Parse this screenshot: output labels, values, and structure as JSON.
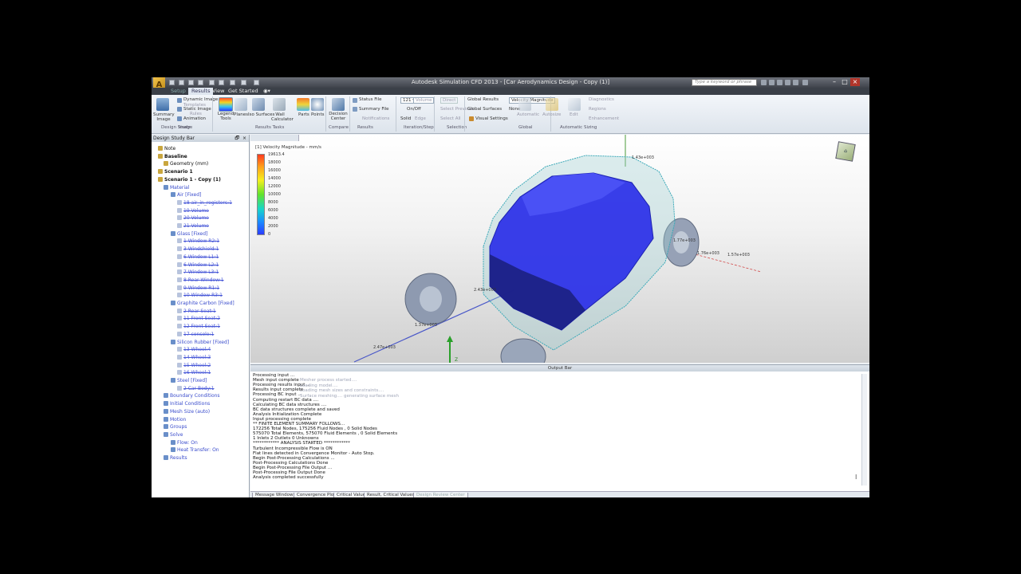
{
  "window": {
    "logo_letter": "A",
    "title": "Autodesk Simulation CFD 2013 - [Car Aerodynamics Design - Copy (1)]",
    "search_placeholder": "Type a keyword or phrase",
    "minimize": "–",
    "maximize": "□",
    "close": "×"
  },
  "tabs": [
    "Setup",
    "Results",
    "View",
    "Get Started"
  ],
  "ribbon": {
    "summary_image": "Summary Image",
    "dynamic_image": "Dynamic Image",
    "static_image": "Static Image",
    "animation": "Animation",
    "templates": "Templates",
    "rules": "Rules",
    "legend_tools": "Legend Tools",
    "planes": "Planes",
    "iso_surfaces": "Iso Surfaces",
    "wall_calculator": "Wall Calculator",
    "parts": "Parts",
    "points": "Points",
    "decision_center": "Decision Center",
    "status_file": "Status File",
    "summary_file": "Summary File",
    "notifications": "Notifications",
    "volume": "Volume",
    "on_off": "On/Off",
    "solid": "Solid",
    "edge": "Edge",
    "direct": "Direct",
    "select_previous": "Select Previous",
    "select_all": "Select All",
    "global_results": "Global Results",
    "global_surfaces": "Global Surfaces",
    "visual_settings": "Visual Settings",
    "velocity_magnitude": "Velocity Magnitude",
    "none": "None",
    "automatic": "Automatic",
    "autosize": "Autosize",
    "edit": "Edit",
    "diagnostics": "Diagnostics",
    "regions": "Regions",
    "enhancement": "Enhancement",
    "group_design_study": "Design Study",
    "group_image": "Image",
    "group_results_tasks": "Results Tasks",
    "group_compare": "Compare",
    "group_results": "Results",
    "group_iteration": "Iteration/Step",
    "group_selection": "Selection",
    "group_global": "Global",
    "group_automatic_sizing": "Automatic Sizing"
  },
  "design_study": {
    "header": "Design Study Bar",
    "tree": [
      {
        "label": "Note",
        "style": "black",
        "indent": 1
      },
      {
        "label": "Baseline",
        "style": "bold",
        "indent": 1
      },
      {
        "label": "Geometry (mm)",
        "style": "black",
        "indent": 2
      },
      {
        "label": "Scenario 1",
        "style": "bold",
        "indent": 1
      },
      {
        "label": "Scenario 1 - Copy (1)",
        "style": "bold",
        "indent": 1
      },
      {
        "label": "Material",
        "style": "blue",
        "indent": 2
      },
      {
        "label": "Air [Fixed]",
        "style": "blue",
        "indent": 3
      },
      {
        "label": "18 air_in_registers:1",
        "style": "strike",
        "indent": 4
      },
      {
        "label": "19 Volume",
        "style": "strike",
        "indent": 4
      },
      {
        "label": "20 Volume",
        "style": "strike",
        "indent": 4
      },
      {
        "label": "21 Volume",
        "style": "strike",
        "indent": 4
      },
      {
        "label": "Glass [Fixed]",
        "style": "blue",
        "indent": 3
      },
      {
        "label": "1 Window R2:1",
        "style": "strike",
        "indent": 4
      },
      {
        "label": "3 Windshield:1",
        "style": "strike",
        "indent": 4
      },
      {
        "label": "6 Window L1:1",
        "style": "strike",
        "indent": 4
      },
      {
        "label": "6 Window L2:1",
        "style": "strike",
        "indent": 4
      },
      {
        "label": "7 Window L3:1",
        "style": "strike",
        "indent": 4
      },
      {
        "label": "8 Rear Window:1",
        "style": "strike",
        "indent": 4
      },
      {
        "label": "9 Window R1:1",
        "style": "strike",
        "indent": 4
      },
      {
        "label": "10 Window R3:1",
        "style": "strike",
        "indent": 4
      },
      {
        "label": "Graphite Carbon [Fixed]",
        "style": "blue",
        "indent": 3
      },
      {
        "label": "2 Rear Seat:1",
        "style": "strike",
        "indent": 4
      },
      {
        "label": "11 Front Seat:2",
        "style": "strike",
        "indent": 4
      },
      {
        "label": "12 Front Seat:1",
        "style": "strike",
        "indent": 4
      },
      {
        "label": "17 console:1",
        "style": "strike",
        "indent": 4
      },
      {
        "label": "Silicon Rubber [Fixed]",
        "style": "blue",
        "indent": 3
      },
      {
        "label": "13 Wheel:4",
        "style": "strike",
        "indent": 4
      },
      {
        "label": "14 Wheel:3",
        "style": "strike",
        "indent": 4
      },
      {
        "label": "15 Wheel:2",
        "style": "strike",
        "indent": 4
      },
      {
        "label": "16 Wheel:1",
        "style": "strike",
        "indent": 4
      },
      {
        "label": "Steel [Fixed]",
        "style": "blue",
        "indent": 3
      },
      {
        "label": "2 Car Body:1",
        "style": "strike",
        "indent": 4
      },
      {
        "label": "Boundary Conditions",
        "style": "blue",
        "indent": 2
      },
      {
        "label": "Initial Conditions",
        "style": "blue",
        "indent": 2
      },
      {
        "label": "Mesh Size (auto)",
        "style": "blue",
        "indent": 2
      },
      {
        "label": "Motion",
        "style": "blue",
        "indent": 2
      },
      {
        "label": "Groups",
        "style": "blue",
        "indent": 2
      },
      {
        "label": "Solve",
        "style": "blue",
        "indent": 2
      },
      {
        "label": "Flow: On",
        "style": "blue",
        "indent": 3
      },
      {
        "label": "Heat Transfer: On",
        "style": "blue",
        "indent": 3
      },
      {
        "label": "Results",
        "style": "blue",
        "indent": 2
      }
    ]
  },
  "legend": {
    "title": "[1] Velocity Magnitude - mm/s",
    "values": [
      "19613.4",
      "18000",
      "16000",
      "14000",
      "12000",
      "10000",
      "8000",
      "6000",
      "4000",
      "2000",
      "0"
    ]
  },
  "view_labels": {
    "a": "1.43e+003",
    "b": "1.77e+003",
    "c": "1.76e+003",
    "d": "1.57e+003",
    "e": "2.43e+003",
    "f": "1.37e+003",
    "g": "2.47e+003",
    "h": "Z"
  },
  "output": {
    "header": "Output Bar",
    "lines": [
      "Processing input ...",
      "Mesh input complete",
      "Processing results input ...",
      "Results input complete",
      "Processing BC input ...",
      "Computing restart BC data ....",
      "Calculating BC data structures ....",
      "BC data structures complete and saved",
      "Analysis Initialization Complete",
      "Input processing complete",
      "** FINITE ELEMENT SUMMARY FOLLOWS...",
      "172256 Total Nodes,    175256 Fluid Nodes ,     0 Solid Nodes",
      "575070 Total Elements,   575070 Fluid Elements ,     0 Solid Elements",
      "1 Inlets   2 Outlets   0 Unknowns",
      "************ ANALYSIS STARTED ************",
      "Turbulent Incompressible Flow is ON",
      "Flat lines detected in Convergence Monitor - Auto Stop.",
      "Begin Post-Processing Calculations ...",
      "Post-Processing Calculations Done",
      "Begin Post-Processing File Output ...",
      "Post-Processing File Output Done",
      "Analysis completed successfully"
    ],
    "ghost_lines": [
      "Mesher process started....",
      "Loading model....",
      "Loading mesh sizes and constraints....",
      "Surface meshing.... generating surface mesh"
    ],
    "tabs": [
      "Message Window",
      "Convergence Plot",
      "Critical Values",
      "Result, Critical Values",
      "Design Review Center"
    ]
  }
}
